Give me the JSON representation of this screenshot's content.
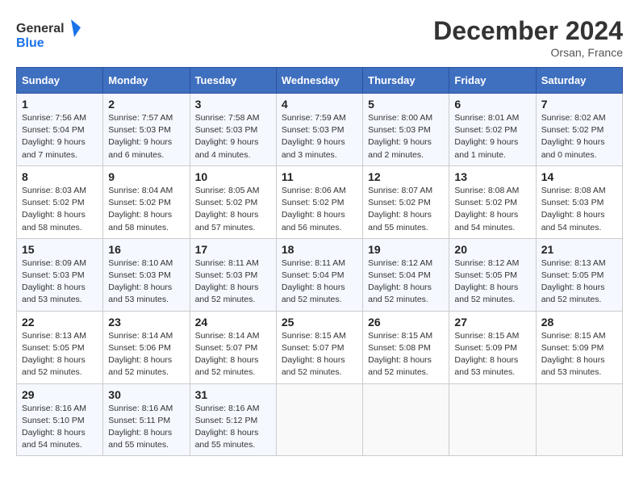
{
  "header": {
    "logo_line1": "General",
    "logo_line2": "Blue",
    "month_title": "December 2024",
    "location": "Orsan, France"
  },
  "weekdays": [
    "Sunday",
    "Monday",
    "Tuesday",
    "Wednesday",
    "Thursday",
    "Friday",
    "Saturday"
  ],
  "weeks": [
    [
      {
        "day": "1",
        "sunrise": "Sunrise: 7:56 AM",
        "sunset": "Sunset: 5:04 PM",
        "daylight": "Daylight: 9 hours and 7 minutes."
      },
      {
        "day": "2",
        "sunrise": "Sunrise: 7:57 AM",
        "sunset": "Sunset: 5:03 PM",
        "daylight": "Daylight: 9 hours and 6 minutes."
      },
      {
        "day": "3",
        "sunrise": "Sunrise: 7:58 AM",
        "sunset": "Sunset: 5:03 PM",
        "daylight": "Daylight: 9 hours and 4 minutes."
      },
      {
        "day": "4",
        "sunrise": "Sunrise: 7:59 AM",
        "sunset": "Sunset: 5:03 PM",
        "daylight": "Daylight: 9 hours and 3 minutes."
      },
      {
        "day": "5",
        "sunrise": "Sunrise: 8:00 AM",
        "sunset": "Sunset: 5:03 PM",
        "daylight": "Daylight: 9 hours and 2 minutes."
      },
      {
        "day": "6",
        "sunrise": "Sunrise: 8:01 AM",
        "sunset": "Sunset: 5:02 PM",
        "daylight": "Daylight: 9 hours and 1 minute."
      },
      {
        "day": "7",
        "sunrise": "Sunrise: 8:02 AM",
        "sunset": "Sunset: 5:02 PM",
        "daylight": "Daylight: 9 hours and 0 minutes."
      }
    ],
    [
      {
        "day": "8",
        "sunrise": "Sunrise: 8:03 AM",
        "sunset": "Sunset: 5:02 PM",
        "daylight": "Daylight: 8 hours and 58 minutes."
      },
      {
        "day": "9",
        "sunrise": "Sunrise: 8:04 AM",
        "sunset": "Sunset: 5:02 PM",
        "daylight": "Daylight: 8 hours and 58 minutes."
      },
      {
        "day": "10",
        "sunrise": "Sunrise: 8:05 AM",
        "sunset": "Sunset: 5:02 PM",
        "daylight": "Daylight: 8 hours and 57 minutes."
      },
      {
        "day": "11",
        "sunrise": "Sunrise: 8:06 AM",
        "sunset": "Sunset: 5:02 PM",
        "daylight": "Daylight: 8 hours and 56 minutes."
      },
      {
        "day": "12",
        "sunrise": "Sunrise: 8:07 AM",
        "sunset": "Sunset: 5:02 PM",
        "daylight": "Daylight: 8 hours and 55 minutes."
      },
      {
        "day": "13",
        "sunrise": "Sunrise: 8:08 AM",
        "sunset": "Sunset: 5:02 PM",
        "daylight": "Daylight: 8 hours and 54 minutes."
      },
      {
        "day": "14",
        "sunrise": "Sunrise: 8:08 AM",
        "sunset": "Sunset: 5:03 PM",
        "daylight": "Daylight: 8 hours and 54 minutes."
      }
    ],
    [
      {
        "day": "15",
        "sunrise": "Sunrise: 8:09 AM",
        "sunset": "Sunset: 5:03 PM",
        "daylight": "Daylight: 8 hours and 53 minutes."
      },
      {
        "day": "16",
        "sunrise": "Sunrise: 8:10 AM",
        "sunset": "Sunset: 5:03 PM",
        "daylight": "Daylight: 8 hours and 53 minutes."
      },
      {
        "day": "17",
        "sunrise": "Sunrise: 8:11 AM",
        "sunset": "Sunset: 5:03 PM",
        "daylight": "Daylight: 8 hours and 52 minutes."
      },
      {
        "day": "18",
        "sunrise": "Sunrise: 8:11 AM",
        "sunset": "Sunset: 5:04 PM",
        "daylight": "Daylight: 8 hours and 52 minutes."
      },
      {
        "day": "19",
        "sunrise": "Sunrise: 8:12 AM",
        "sunset": "Sunset: 5:04 PM",
        "daylight": "Daylight: 8 hours and 52 minutes."
      },
      {
        "day": "20",
        "sunrise": "Sunrise: 8:12 AM",
        "sunset": "Sunset: 5:05 PM",
        "daylight": "Daylight: 8 hours and 52 minutes."
      },
      {
        "day": "21",
        "sunrise": "Sunrise: 8:13 AM",
        "sunset": "Sunset: 5:05 PM",
        "daylight": "Daylight: 8 hours and 52 minutes."
      }
    ],
    [
      {
        "day": "22",
        "sunrise": "Sunrise: 8:13 AM",
        "sunset": "Sunset: 5:05 PM",
        "daylight": "Daylight: 8 hours and 52 minutes."
      },
      {
        "day": "23",
        "sunrise": "Sunrise: 8:14 AM",
        "sunset": "Sunset: 5:06 PM",
        "daylight": "Daylight: 8 hours and 52 minutes."
      },
      {
        "day": "24",
        "sunrise": "Sunrise: 8:14 AM",
        "sunset": "Sunset: 5:07 PM",
        "daylight": "Daylight: 8 hours and 52 minutes."
      },
      {
        "day": "25",
        "sunrise": "Sunrise: 8:15 AM",
        "sunset": "Sunset: 5:07 PM",
        "daylight": "Daylight: 8 hours and 52 minutes."
      },
      {
        "day": "26",
        "sunrise": "Sunrise: 8:15 AM",
        "sunset": "Sunset: 5:08 PM",
        "daylight": "Daylight: 8 hours and 52 minutes."
      },
      {
        "day": "27",
        "sunrise": "Sunrise: 8:15 AM",
        "sunset": "Sunset: 5:09 PM",
        "daylight": "Daylight: 8 hours and 53 minutes."
      },
      {
        "day": "28",
        "sunrise": "Sunrise: 8:15 AM",
        "sunset": "Sunset: 5:09 PM",
        "daylight": "Daylight: 8 hours and 53 minutes."
      }
    ],
    [
      {
        "day": "29",
        "sunrise": "Sunrise: 8:16 AM",
        "sunset": "Sunset: 5:10 PM",
        "daylight": "Daylight: 8 hours and 54 minutes."
      },
      {
        "day": "30",
        "sunrise": "Sunrise: 8:16 AM",
        "sunset": "Sunset: 5:11 PM",
        "daylight": "Daylight: 8 hours and 55 minutes."
      },
      {
        "day": "31",
        "sunrise": "Sunrise: 8:16 AM",
        "sunset": "Sunset: 5:12 PM",
        "daylight": "Daylight: 8 hours and 55 minutes."
      },
      null,
      null,
      null,
      null
    ]
  ]
}
